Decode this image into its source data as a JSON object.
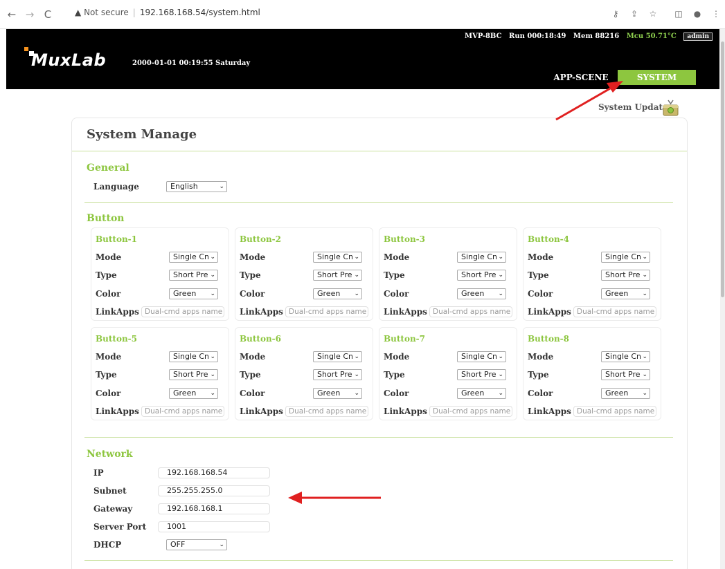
{
  "browser": {
    "security_label": "Not secure",
    "url": "192.168.168.54/system.html"
  },
  "header": {
    "brand": "MuxLab",
    "datetime": "2000-01-01 00:19:55 Saturday",
    "status": {
      "model": "MVP-8BC",
      "run": "Run 000:18:49",
      "mem": "Mem 88216",
      "mcu": "Mcu 50.71°C",
      "user": "admin"
    },
    "menu": {
      "scene": "APP-SCENE",
      "system": "SYSTEM"
    }
  },
  "system_update": "System Update",
  "page_title": "System Manage",
  "general": {
    "title": "General",
    "language_label": "Language",
    "language_value": "English"
  },
  "button_section": {
    "title": "Button",
    "mode_label": "Mode",
    "type_label": "Type",
    "color_label": "Color",
    "linkapps_label": "LinkApps",
    "linkapps_placeholder": "Dual-cmd apps name",
    "buttons": [
      {
        "name": "Button-1",
        "mode": "Single Cn",
        "type": "Short Pre",
        "color": "Green"
      },
      {
        "name": "Button-2",
        "mode": "Single Cn",
        "type": "Short Pre",
        "color": "Green"
      },
      {
        "name": "Button-3",
        "mode": "Single Cn",
        "type": "Short Pre",
        "color": "Green"
      },
      {
        "name": "Button-4",
        "mode": "Single Cn",
        "type": "Short Pre",
        "color": "Green"
      },
      {
        "name": "Button-5",
        "mode": "Single Cn",
        "type": "Short Pre",
        "color": "Green"
      },
      {
        "name": "Button-6",
        "mode": "Single Cn",
        "type": "Short Pre",
        "color": "Green"
      },
      {
        "name": "Button-7",
        "mode": "Single Cn",
        "type": "Short Pre",
        "color": "Green"
      },
      {
        "name": "Button-8",
        "mode": "Single Cn",
        "type": "Short Pre",
        "color": "Green"
      }
    ]
  },
  "network": {
    "title": "Network",
    "ip_label": "IP",
    "ip": "192.168.168.54",
    "subnet_label": "Subnet",
    "subnet": "255.255.255.0",
    "gateway_label": "Gateway",
    "gateway": "192.168.168.1",
    "port_label": "Server Port",
    "port": "1001",
    "dhcp_label": "DHCP",
    "dhcp": "OFF"
  },
  "colors": {
    "accent": "#8dc63f",
    "header_bg": "#000000",
    "annotation_arrow": "#e02020"
  }
}
